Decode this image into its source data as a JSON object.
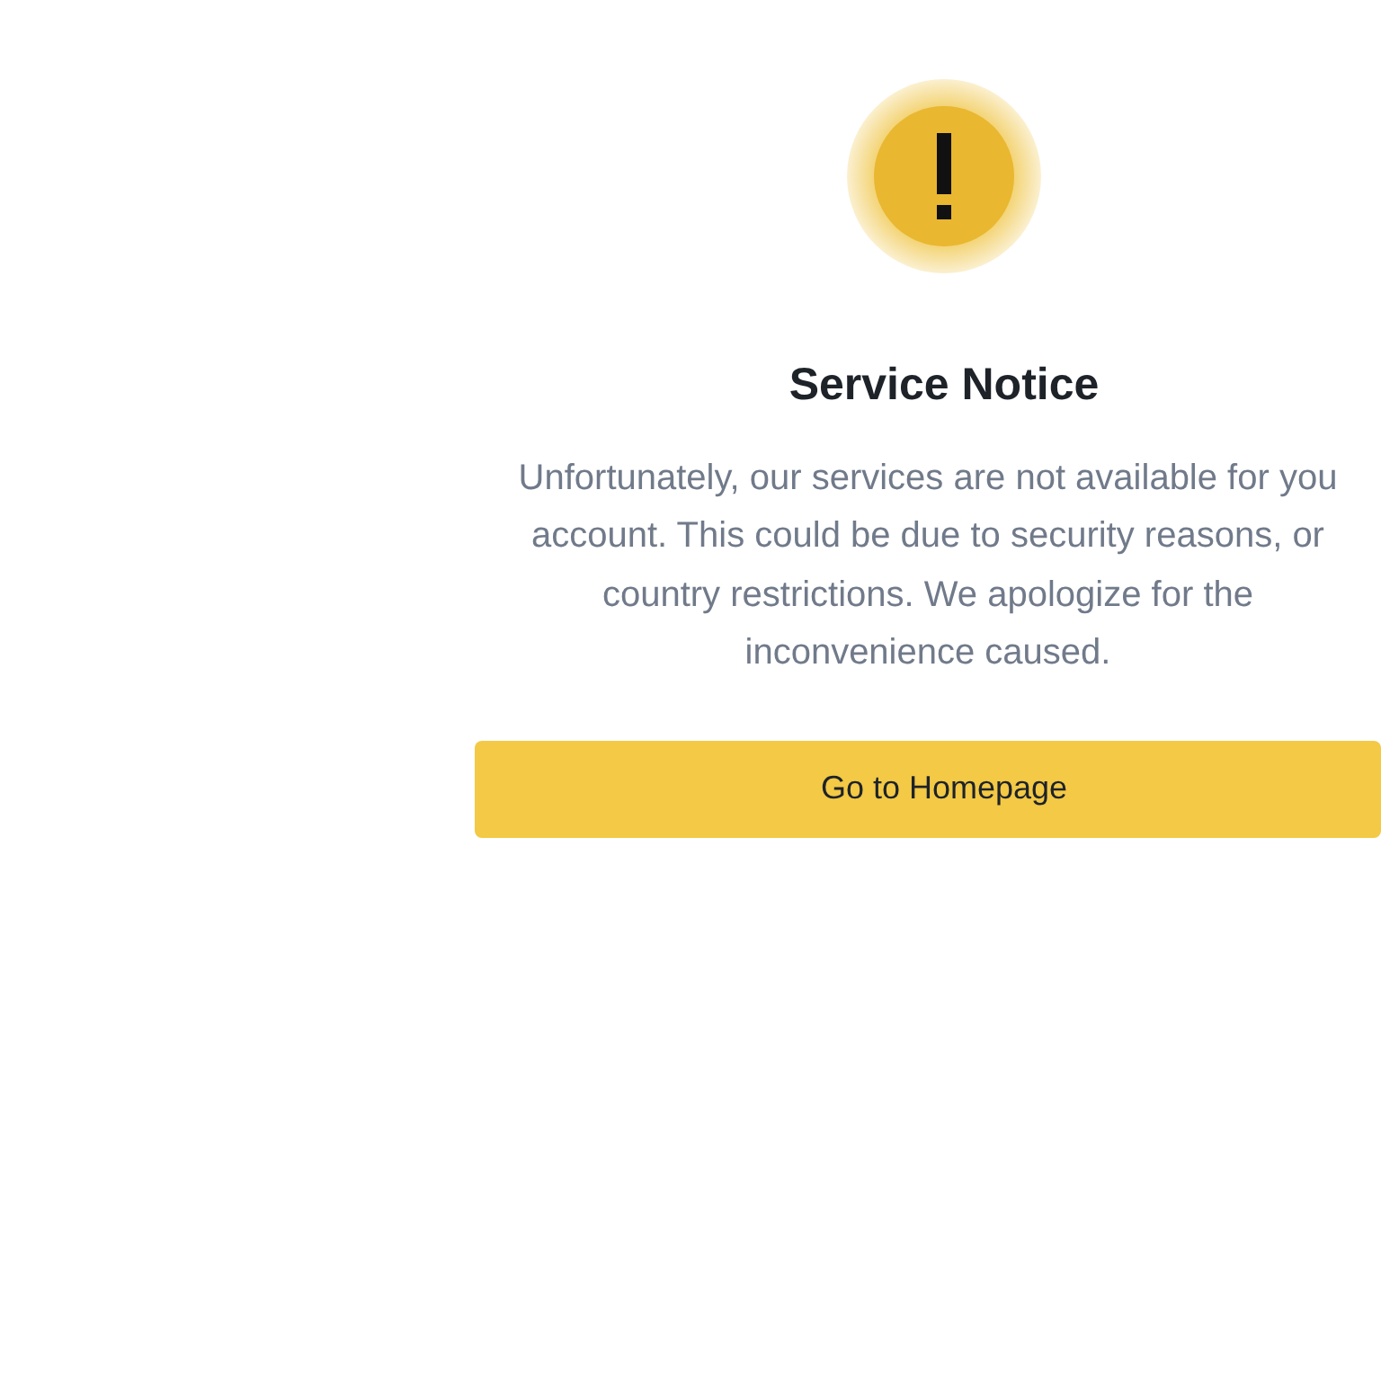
{
  "notice": {
    "title": "Service Notice",
    "message_lines": [
      "Unfortunately, our services are not available for you",
      "account. This could be due to security reasons, or",
      "country restrictions. We apologize for the",
      "inconvenience caused."
    ],
    "button": "Go to Homepage"
  }
}
